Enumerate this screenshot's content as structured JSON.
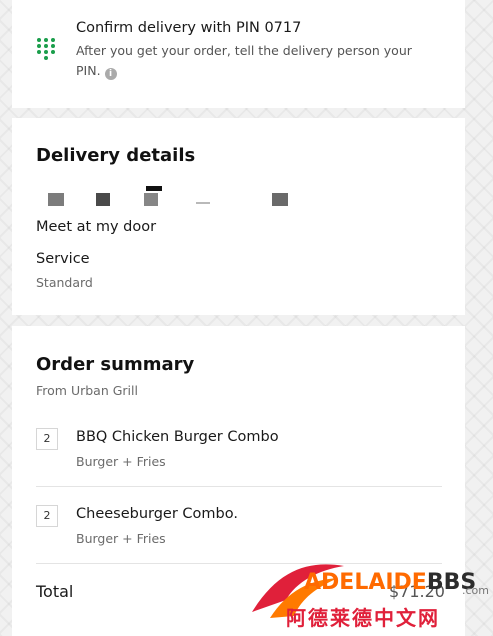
{
  "pin_card": {
    "title": "Confirm delivery with PIN 0717",
    "description": "After you get your order, tell the delivery person your PIN.",
    "icon": "keypad-icon"
  },
  "delivery": {
    "title": "Delivery details",
    "dropoff": "Meet at my door",
    "service_label": "Service",
    "service_value": "Standard"
  },
  "order": {
    "title": "Order summary",
    "from": "From Urban Grill",
    "items": [
      {
        "qty": "2",
        "name": "BBQ Chicken Burger Combo",
        "options": "Burger + Fries"
      },
      {
        "qty": "2",
        "name": "Cheeseburger Combo.",
        "options": "Burger + Fries"
      }
    ],
    "total_label": "Total",
    "total_value": "$71.20"
  },
  "watermark": {
    "brand_left": "ADELAIDE",
    "brand_right": "BBS",
    "suffix": ".com",
    "cn": "阿德莱德中文网"
  },
  "colors": {
    "pin_icon": "#1a9e4b",
    "watermark_orange": "#ff6a00",
    "watermark_red": "#e0203a"
  }
}
